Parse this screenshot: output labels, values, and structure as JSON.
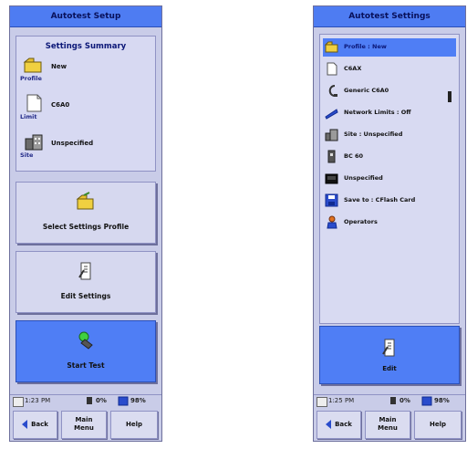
{
  "left_screen": {
    "title": "Autotest Setup",
    "summary": {
      "heading": "Settings Summary",
      "rows": [
        {
          "caption": "Profile",
          "value": "New",
          "icon": "folder-icon"
        },
        {
          "caption": "Limit",
          "value": "C6A0",
          "icon": "document-icon"
        },
        {
          "caption": "Site",
          "value": "Unspecified",
          "icon": "building-icon"
        }
      ]
    },
    "buttons": {
      "select_profile": "Select Settings Profile",
      "edit_settings": "Edit Settings",
      "start_test": "Start Test"
    },
    "status": {
      "time": "1:23 PM",
      "memory": "0%",
      "battery": "98%"
    },
    "softkeys": {
      "back": "Back",
      "main_line1": "Main",
      "main_line2": "Menu",
      "help": "Help"
    }
  },
  "right_screen": {
    "title": "Autotest Settings",
    "items": [
      {
        "label": "Profile : New",
        "icon": "folder-icon",
        "selected": true
      },
      {
        "label": "C6AX",
        "icon": "document-icon",
        "selected": false
      },
      {
        "label": "Generic C6A0",
        "icon": "cable-icon",
        "selected": false
      },
      {
        "label": "Network Limits : Off",
        "icon": "network-icon",
        "selected": false
      },
      {
        "label": "Site : Unspecified",
        "icon": "building-icon",
        "selected": false
      },
      {
        "label": "BC 60",
        "icon": "connector-icon",
        "selected": false
      },
      {
        "label": "Unspecified",
        "icon": "device-icon",
        "selected": false
      },
      {
        "label": "Save to : CFlash Card",
        "icon": "save-icon",
        "selected": false
      },
      {
        "label": "Operators",
        "icon": "operators-icon",
        "selected": false
      }
    ],
    "button": {
      "edit": "Edit"
    },
    "status": {
      "time": "1:25 PM",
      "memory": "0%",
      "battery": "98%"
    },
    "softkeys": {
      "back": "Back",
      "main_line1": "Main",
      "main_line2": "Menu",
      "help": "Help"
    }
  },
  "colors": {
    "titlebar": "#4e7cf2",
    "panel": "#c9cce8",
    "accent": "#2b4fb8"
  }
}
